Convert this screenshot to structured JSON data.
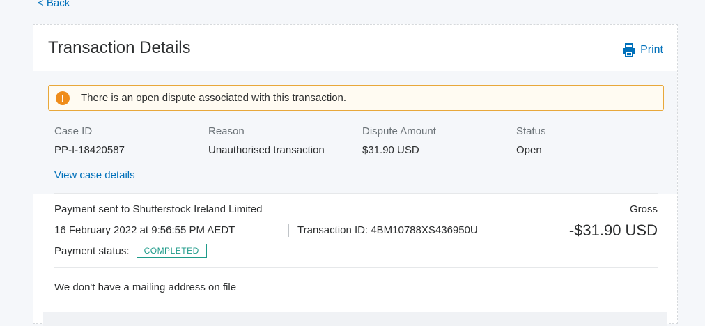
{
  "nav": {
    "back_label": "< Back"
  },
  "header": {
    "title": "Transaction Details",
    "print_label": "Print"
  },
  "alert": {
    "icon": "exclamation-icon",
    "text": "There is an open dispute associated with this transaction."
  },
  "dispute": {
    "columns": [
      {
        "label": "Case ID",
        "value": "PP-I-18420587"
      },
      {
        "label": "Reason",
        "value": "Unauthorised transaction"
      },
      {
        "label": "Dispute Amount",
        "value": "$31.90 USD"
      },
      {
        "label": "Status",
        "value": "Open"
      }
    ],
    "view_case_label": "View case details"
  },
  "payment": {
    "description": "Payment sent to Shutterstock Ireland Limited",
    "date": "16 February 2022 at 9:56:55 PM AEDT",
    "transaction_id": "Transaction ID: 4BM10788XS436950U",
    "status_label": "Payment status:",
    "status_value": "COMPLETED",
    "gross_label": "Gross",
    "gross_amount": "-$31.90 USD"
  },
  "address": {
    "text": "We don't have a mailing address on file"
  },
  "colors": {
    "link": "#0070ba",
    "alert_border": "#e8a83b",
    "alert_icon": "#ef8c1a",
    "status_badge": "#1f9b8a"
  }
}
